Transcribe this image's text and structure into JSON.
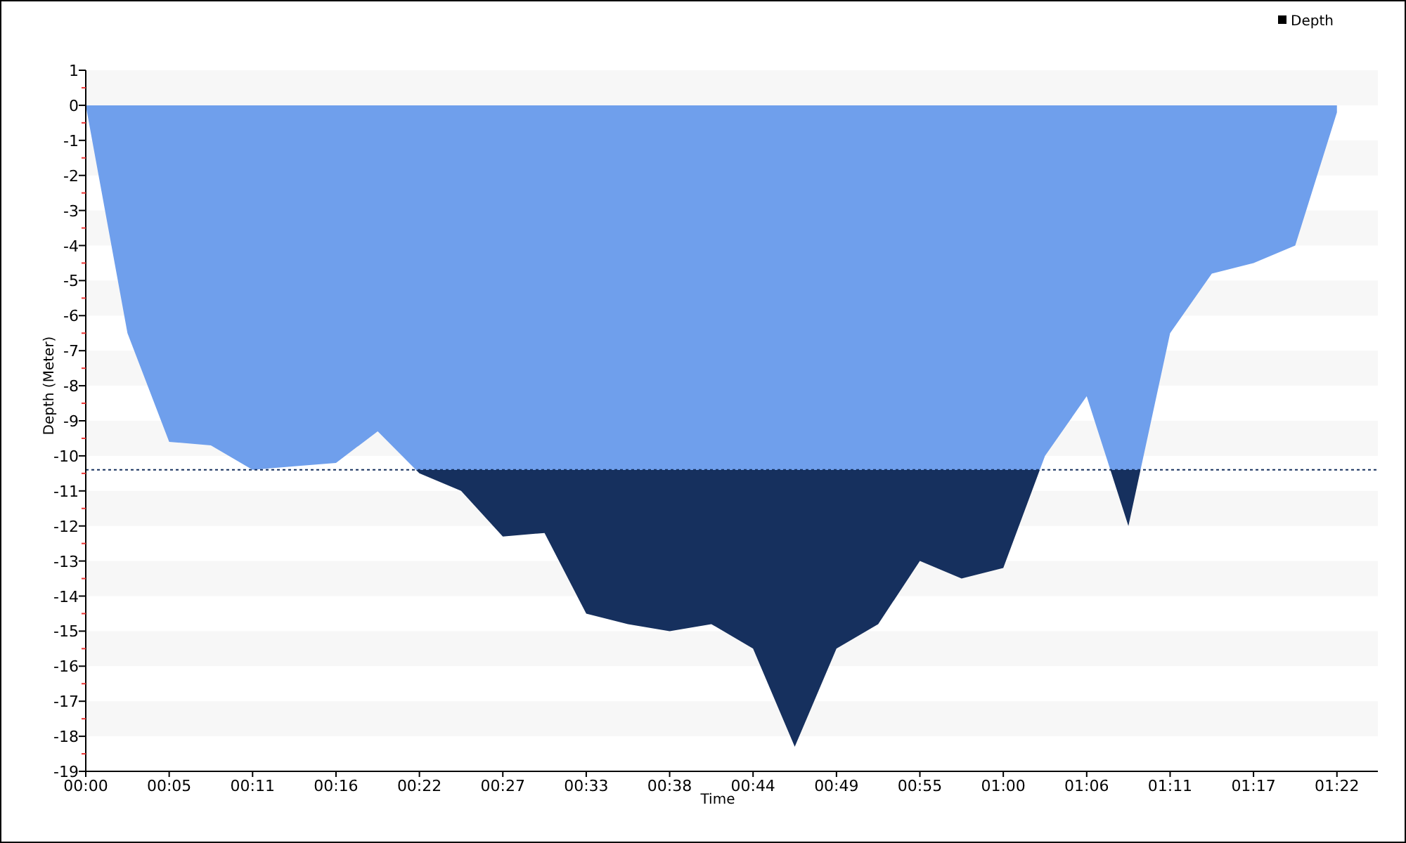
{
  "chart_data": {
    "type": "area",
    "xlabel": "Time",
    "ylabel": "Depth (Meter)",
    "x": [
      0,
      2.75,
      5.5,
      8.25,
      11,
      13.75,
      16.5,
      19.25,
      22,
      24.75,
      27.5,
      30.25,
      33,
      35.75,
      38.5,
      41.25,
      44,
      46.75,
      49.5,
      52.25,
      55,
      57.75,
      60.5,
      63.25,
      66,
      68.75,
      71.5,
      74.25,
      77,
      79.75,
      82.5
    ],
    "series": [
      {
        "name": "Depth",
        "color": "#6f9fec",
        "values": [
          0,
          -6.5,
          -9.6,
          -9.7,
          -10.4,
          -10.3,
          -10.2,
          -9.3,
          -10.5,
          -11,
          -12.3,
          -12.2,
          -14.5,
          -14.8,
          -15,
          -14.8,
          -15.5,
          -18.3,
          -15.5,
          -14.8,
          -13,
          -13.5,
          -13.2,
          -10,
          -8.3,
          -12,
          -6.5,
          -4.8,
          -4.5,
          -4,
          -0.2
        ]
      }
    ],
    "xlim": [
      0,
      85.2
    ],
    "ylim": [
      -19,
      1
    ],
    "xticks": [
      {
        "value": 0,
        "label": "00:00"
      },
      {
        "value": 5.5,
        "label": "00:05"
      },
      {
        "value": 11,
        "label": "00:11"
      },
      {
        "value": 16.5,
        "label": "00:16"
      },
      {
        "value": 22,
        "label": "00:22"
      },
      {
        "value": 27.5,
        "label": "00:27"
      },
      {
        "value": 33,
        "label": "00:33"
      },
      {
        "value": 38.5,
        "label": "00:38"
      },
      {
        "value": 44,
        "label": "00:44"
      },
      {
        "value": 49.5,
        "label": "00:49"
      },
      {
        "value": 55,
        "label": "00:55"
      },
      {
        "value": 60.5,
        "label": "01:00"
      },
      {
        "value": 66,
        "label": "01:06"
      },
      {
        "value": 71.5,
        "label": "01:11"
      },
      {
        "value": 77,
        "label": "01:17"
      },
      {
        "value": 82.5,
        "label": "01:22"
      }
    ],
    "yticks": [
      1,
      0,
      -1,
      -2,
      -3,
      -4,
      -5,
      -6,
      -7,
      -8,
      -9,
      -10,
      -11,
      -12,
      -13,
      -14,
      -15,
      -16,
      -17,
      -18,
      -19
    ],
    "ref_lines": [
      {
        "axis": "y",
        "value": -10.4,
        "color": "#16305e"
      }
    ]
  }
}
